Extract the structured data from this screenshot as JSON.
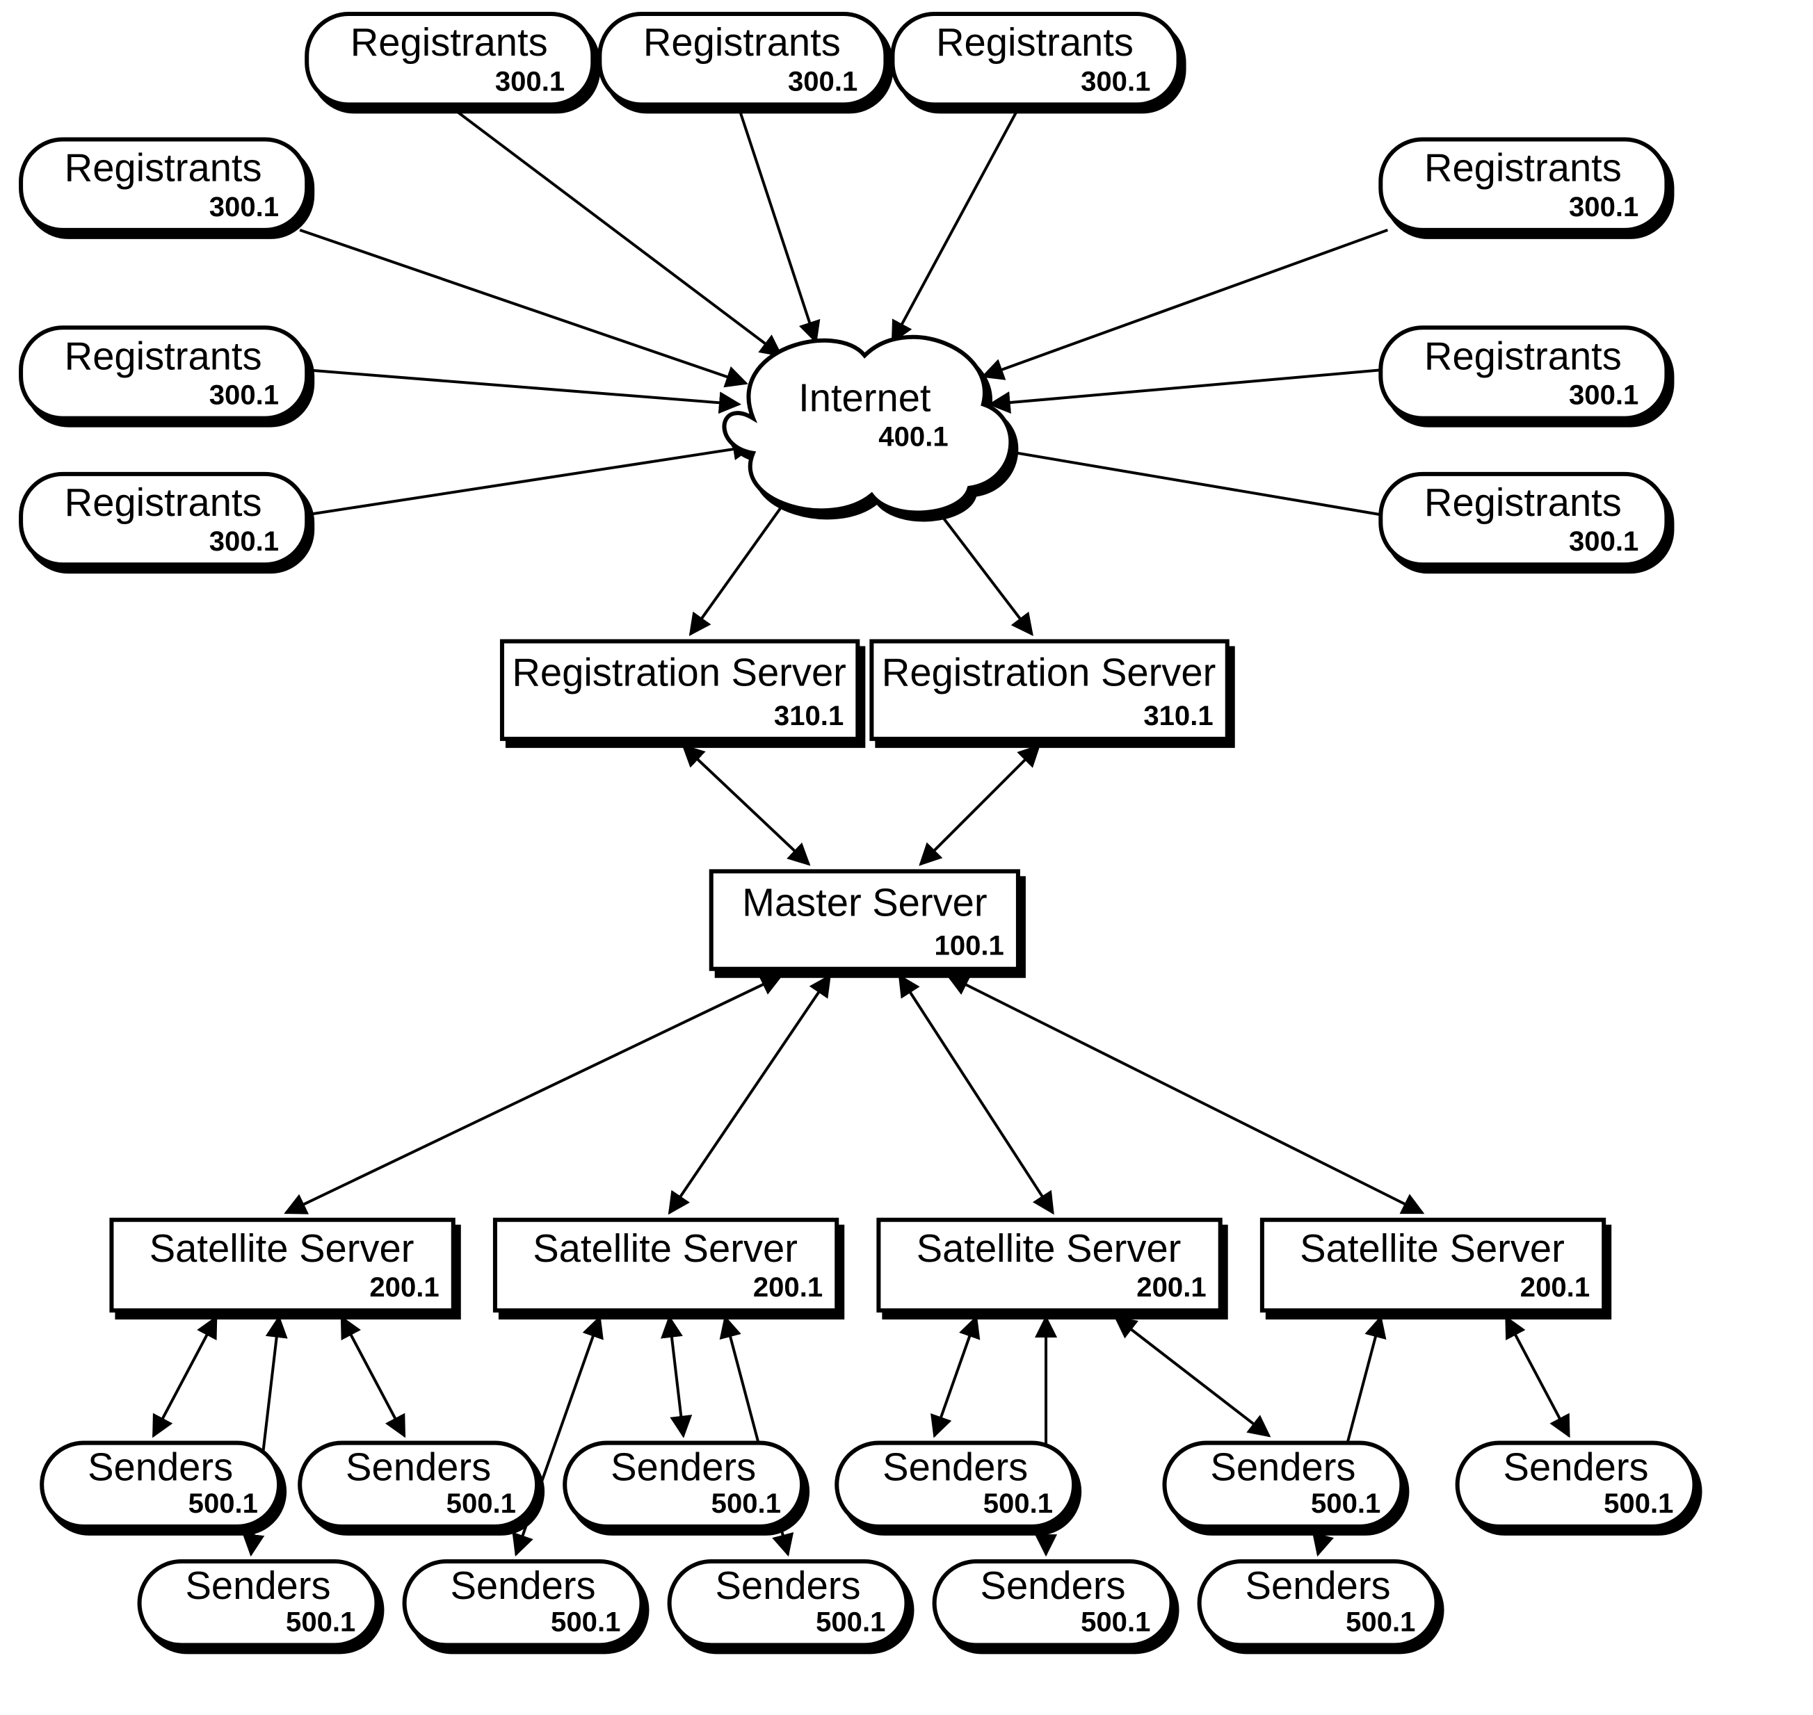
{
  "nodes": {
    "reg_tl": {
      "label": "Registrants",
      "ref": "300.1"
    },
    "reg_tc": {
      "label": "Registrants",
      "ref": "300.1"
    },
    "reg_tr": {
      "label": "Registrants",
      "ref": "300.1"
    },
    "reg_l1": {
      "label": "Registrants",
      "ref": "300.1"
    },
    "reg_l2": {
      "label": "Registrants",
      "ref": "300.1"
    },
    "reg_l3": {
      "label": "Registrants",
      "ref": "300.1"
    },
    "reg_r1": {
      "label": "Registrants",
      "ref": "300.1"
    },
    "reg_r2": {
      "label": "Registrants",
      "ref": "300.1"
    },
    "reg_r3": {
      "label": "Registrants",
      "ref": "300.1"
    },
    "internet": {
      "label": "Internet",
      "ref": "400.1"
    },
    "regsrv1": {
      "label": "Registration Server",
      "ref": "310.1"
    },
    "regsrv2": {
      "label": "Registration Server",
      "ref": "310.1"
    },
    "master": {
      "label": "Master Server",
      "ref": "100.1"
    },
    "sat1": {
      "label": "Satellite Server",
      "ref": "200.1"
    },
    "sat2": {
      "label": "Satellite Server",
      "ref": "200.1"
    },
    "sat3": {
      "label": "Satellite Server",
      "ref": "200.1"
    },
    "sat4": {
      "label": "Satellite Server",
      "ref": "200.1"
    },
    "snd1": {
      "label": "Senders",
      "ref": "500.1"
    },
    "snd2": {
      "label": "Senders",
      "ref": "500.1"
    },
    "snd3": {
      "label": "Senders",
      "ref": "500.1"
    },
    "snd4": {
      "label": "Senders",
      "ref": "500.1"
    },
    "snd5": {
      "label": "Senders",
      "ref": "500.1"
    },
    "snd6": {
      "label": "Senders",
      "ref": "500.1"
    },
    "snd7": {
      "label": "Senders",
      "ref": "500.1"
    },
    "snd8": {
      "label": "Senders",
      "ref": "500.1"
    },
    "snd9": {
      "label": "Senders",
      "ref": "500.1"
    },
    "snd10": {
      "label": "Senders",
      "ref": "500.1"
    },
    "snd11": {
      "label": "Senders",
      "ref": "500.1"
    }
  }
}
